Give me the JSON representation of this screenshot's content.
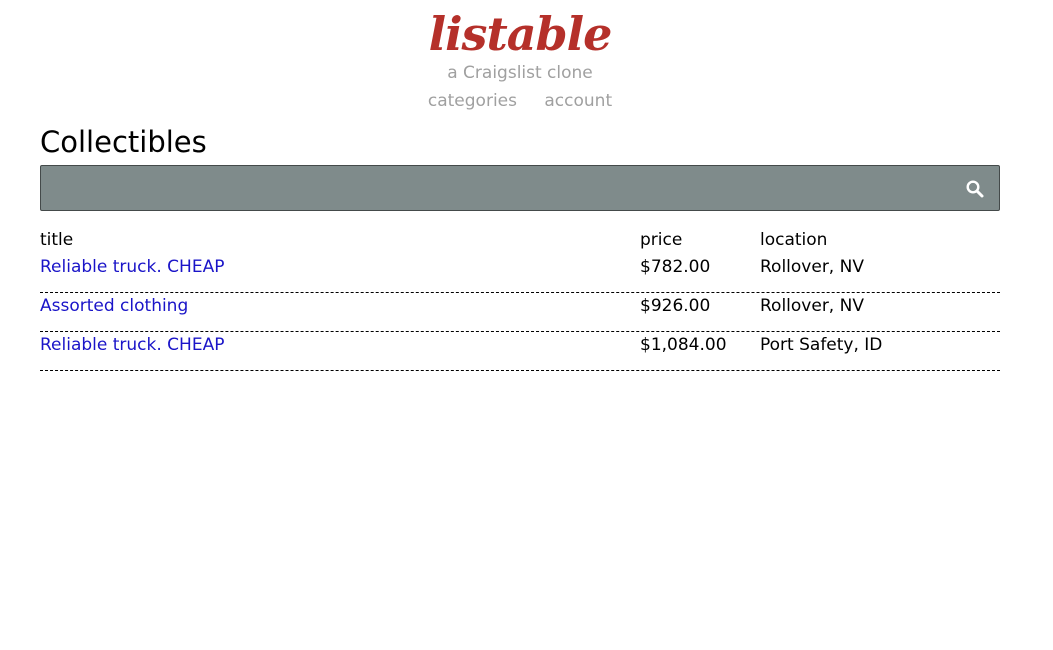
{
  "header": {
    "logo_text": "listable",
    "tagline": "a Craigslist clone",
    "nav": [
      {
        "label": "categories"
      },
      {
        "label": "account"
      }
    ]
  },
  "page": {
    "title": "Collectibles"
  },
  "search": {
    "value": "",
    "placeholder": "",
    "icon": "search-icon"
  },
  "listing": {
    "columns": {
      "title": "title",
      "price": "price",
      "location": "location"
    },
    "rows": [
      {
        "title": "Reliable truck. CHEAP",
        "price": "$782.00",
        "location": "Rollover, NV"
      },
      {
        "title": "Assorted clothing",
        "price": "$926.00",
        "location": "Rollover, NV"
      },
      {
        "title": "Reliable truck. CHEAP",
        "price": "$1,084.00",
        "location": "Port Safety, ID"
      }
    ]
  },
  "colors": {
    "logo": "#b5302a",
    "muted_text": "#a0a0a0",
    "link": "#1a14c8",
    "search_bg": "#7f8b8b",
    "search_border": "#444a4a"
  }
}
